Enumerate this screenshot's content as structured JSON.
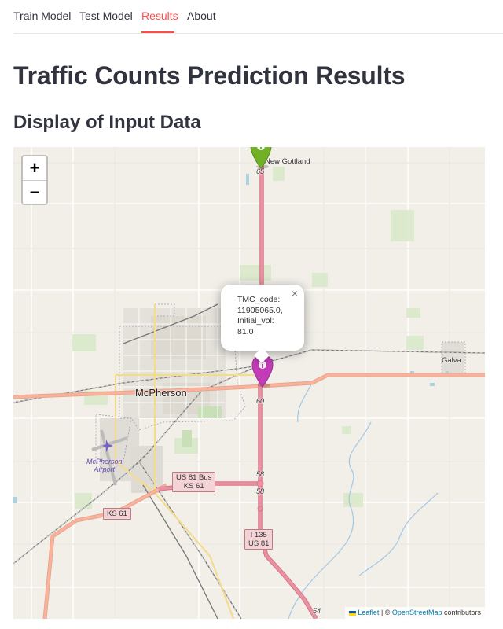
{
  "tabs": [
    {
      "label": "Train Model"
    },
    {
      "label": "Test Model"
    },
    {
      "label": "Results"
    },
    {
      "label": "About"
    }
  ],
  "active_tab": "Results",
  "page_title": "Traffic Counts Prediction Results",
  "section_title": "Display of Input Data",
  "map": {
    "zoom_in_label": "+",
    "zoom_out_label": "−",
    "popup": {
      "line1": "TMC_code:",
      "line2": "11905065.0,",
      "line3": "Initial_vol:",
      "line4": "81.0",
      "close_label": "×"
    },
    "places": {
      "new_gottland": "New Gottland",
      "mcpherson": "McPherson",
      "galva": "Galva",
      "airport_line1": "McPherson",
      "airport_line2": "Airport"
    },
    "shields": {
      "us81bus_line1": "US 81 Bus",
      "us81bus_line2": "KS 61",
      "ks61": "KS 61",
      "i135_line1": "I 135",
      "i135_line2": "US 81"
    },
    "route_numbers": {
      "r65": "65",
      "r60a": "60",
      "r60b": "60",
      "r58a": "58",
      "r58b": "58",
      "r54": "54"
    },
    "markers": [
      {
        "color": "#72b026",
        "icon": "info-icon"
      },
      {
        "color": "#c13cb6",
        "icon": "info-icon"
      }
    ],
    "attribution": {
      "leaflet": "Leaflet",
      "separator": " | © ",
      "osm": "OpenStreetMap",
      "suffix": " contributors"
    }
  },
  "colors": {
    "accent": "#ff4b4b",
    "highway": "#e892a2",
    "trunk": "#f9b29c",
    "map_bg": "#f2efe9"
  }
}
